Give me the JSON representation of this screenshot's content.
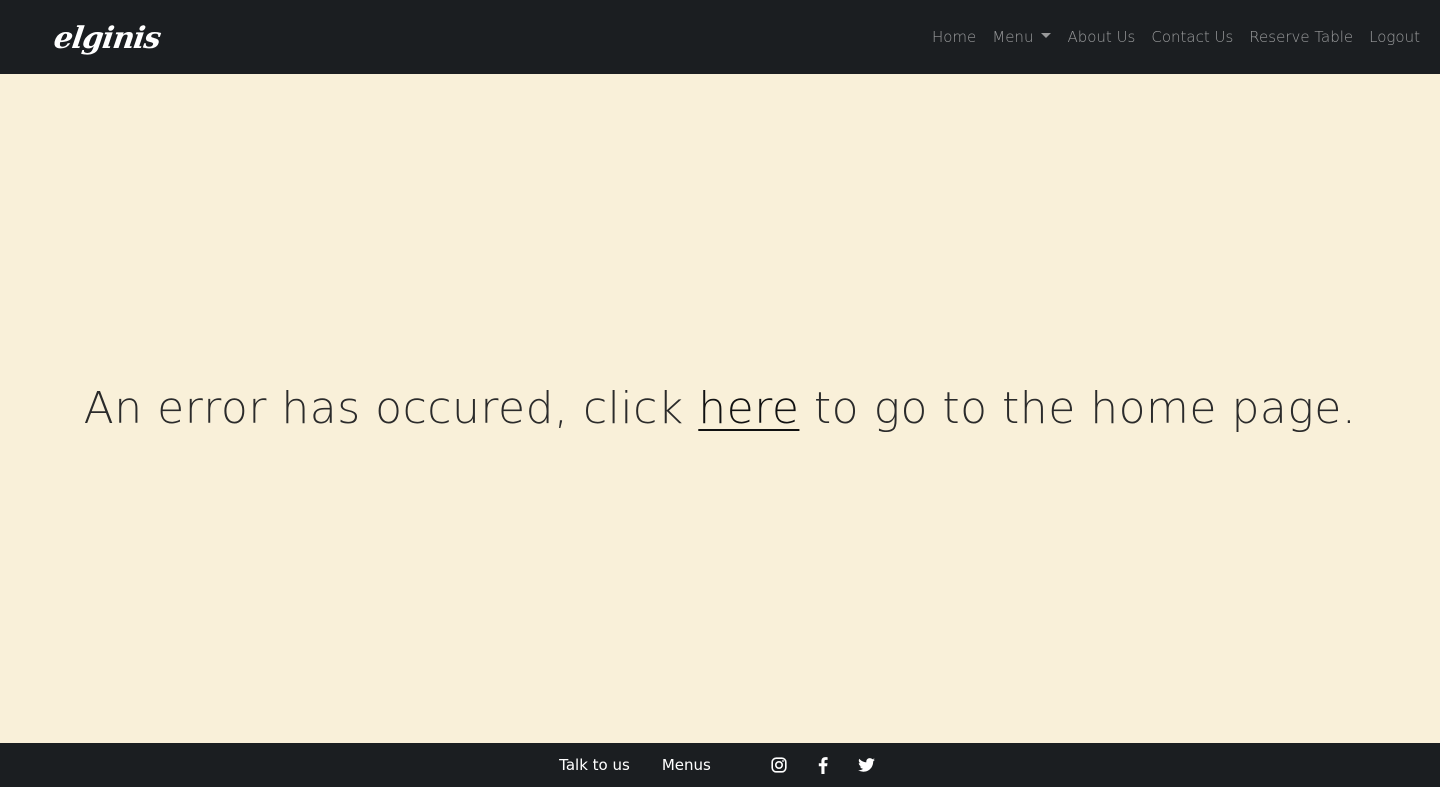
{
  "brand": {
    "logo_text": "elginis"
  },
  "nav": {
    "items": [
      {
        "label": "Home"
      },
      {
        "label": "Menu",
        "has_dropdown": true
      },
      {
        "label": "About Us"
      },
      {
        "label": "Contact Us"
      },
      {
        "label": "Reserve Table"
      },
      {
        "label": "Logout"
      }
    ]
  },
  "main": {
    "message_before": "An error has occured, click ",
    "link_text": "here",
    "message_after": " to go to the home page."
  },
  "footer": {
    "talk_label": "Talk to us",
    "menus_label": "Menus",
    "social": [
      {
        "icon": "instagram-icon"
      },
      {
        "icon": "facebook-icon"
      },
      {
        "icon": "twitter-icon"
      }
    ]
  },
  "colors": {
    "navbar_bg": "#1b1e21",
    "page_bg": "#f9f0d9",
    "nav_text": "rgba(255,255,255,0.55)",
    "text": "#2b2b2b"
  }
}
